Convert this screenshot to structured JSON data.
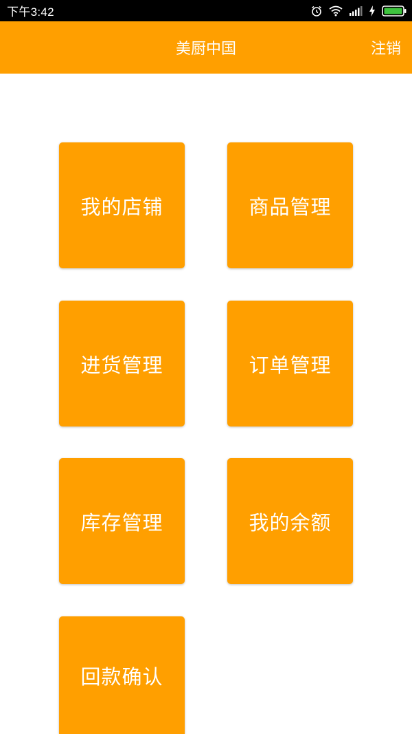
{
  "status_bar": {
    "time": "下午3:42",
    "icons": [
      "alarm-icon",
      "wifi-icon",
      "signal-icon",
      "charging-icon",
      "battery-icon"
    ]
  },
  "app_bar": {
    "title": "美厨中国",
    "logout_label": "注销",
    "background_color": "#ff9f00"
  },
  "tiles": [
    {
      "label": "我的店铺"
    },
    {
      "label": "商品管理"
    },
    {
      "label": "进货管理"
    },
    {
      "label": "订单管理"
    },
    {
      "label": "库存管理"
    },
    {
      "label": "我的余额"
    },
    {
      "label": "回款确认"
    }
  ],
  "colors": {
    "accent": "#ff9f00",
    "status_bar": "#000000",
    "text_on_accent": "#ffffff"
  }
}
